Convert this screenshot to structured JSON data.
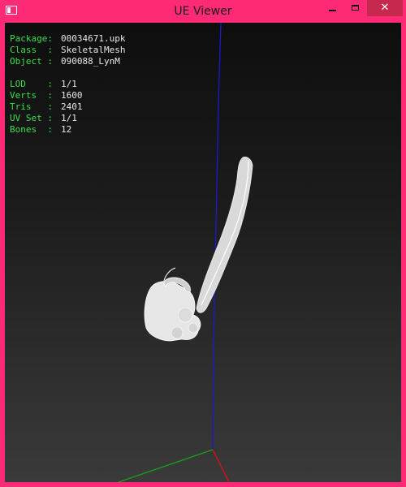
{
  "window": {
    "title": "UE Viewer",
    "controls": {
      "minimize": "minimize",
      "maximize": "maximize",
      "close": "✕"
    }
  },
  "info": {
    "package_key": "Package:",
    "package": "00034671.upk",
    "class_key": "Class  :",
    "class": "SkeletalMesh",
    "object_key": "Object :",
    "object": "090088_LynM",
    "lod_key": "LOD    :",
    "lod": "1/1",
    "verts_key": "Verts  :",
    "verts": "1600",
    "tris_key": "Tris   :",
    "tris": "2401",
    "uvset_key": "UV Set :",
    "uvset": "1/1",
    "bones_key": "Bones  :",
    "bones": "12"
  },
  "colors": {
    "frame": "#ff2a75",
    "close_button": "#c7284d",
    "label_green": "#39e04a",
    "axis_x": "#e01010",
    "axis_y": "#1aa01a",
    "axis_z": "#1a1ad0"
  }
}
